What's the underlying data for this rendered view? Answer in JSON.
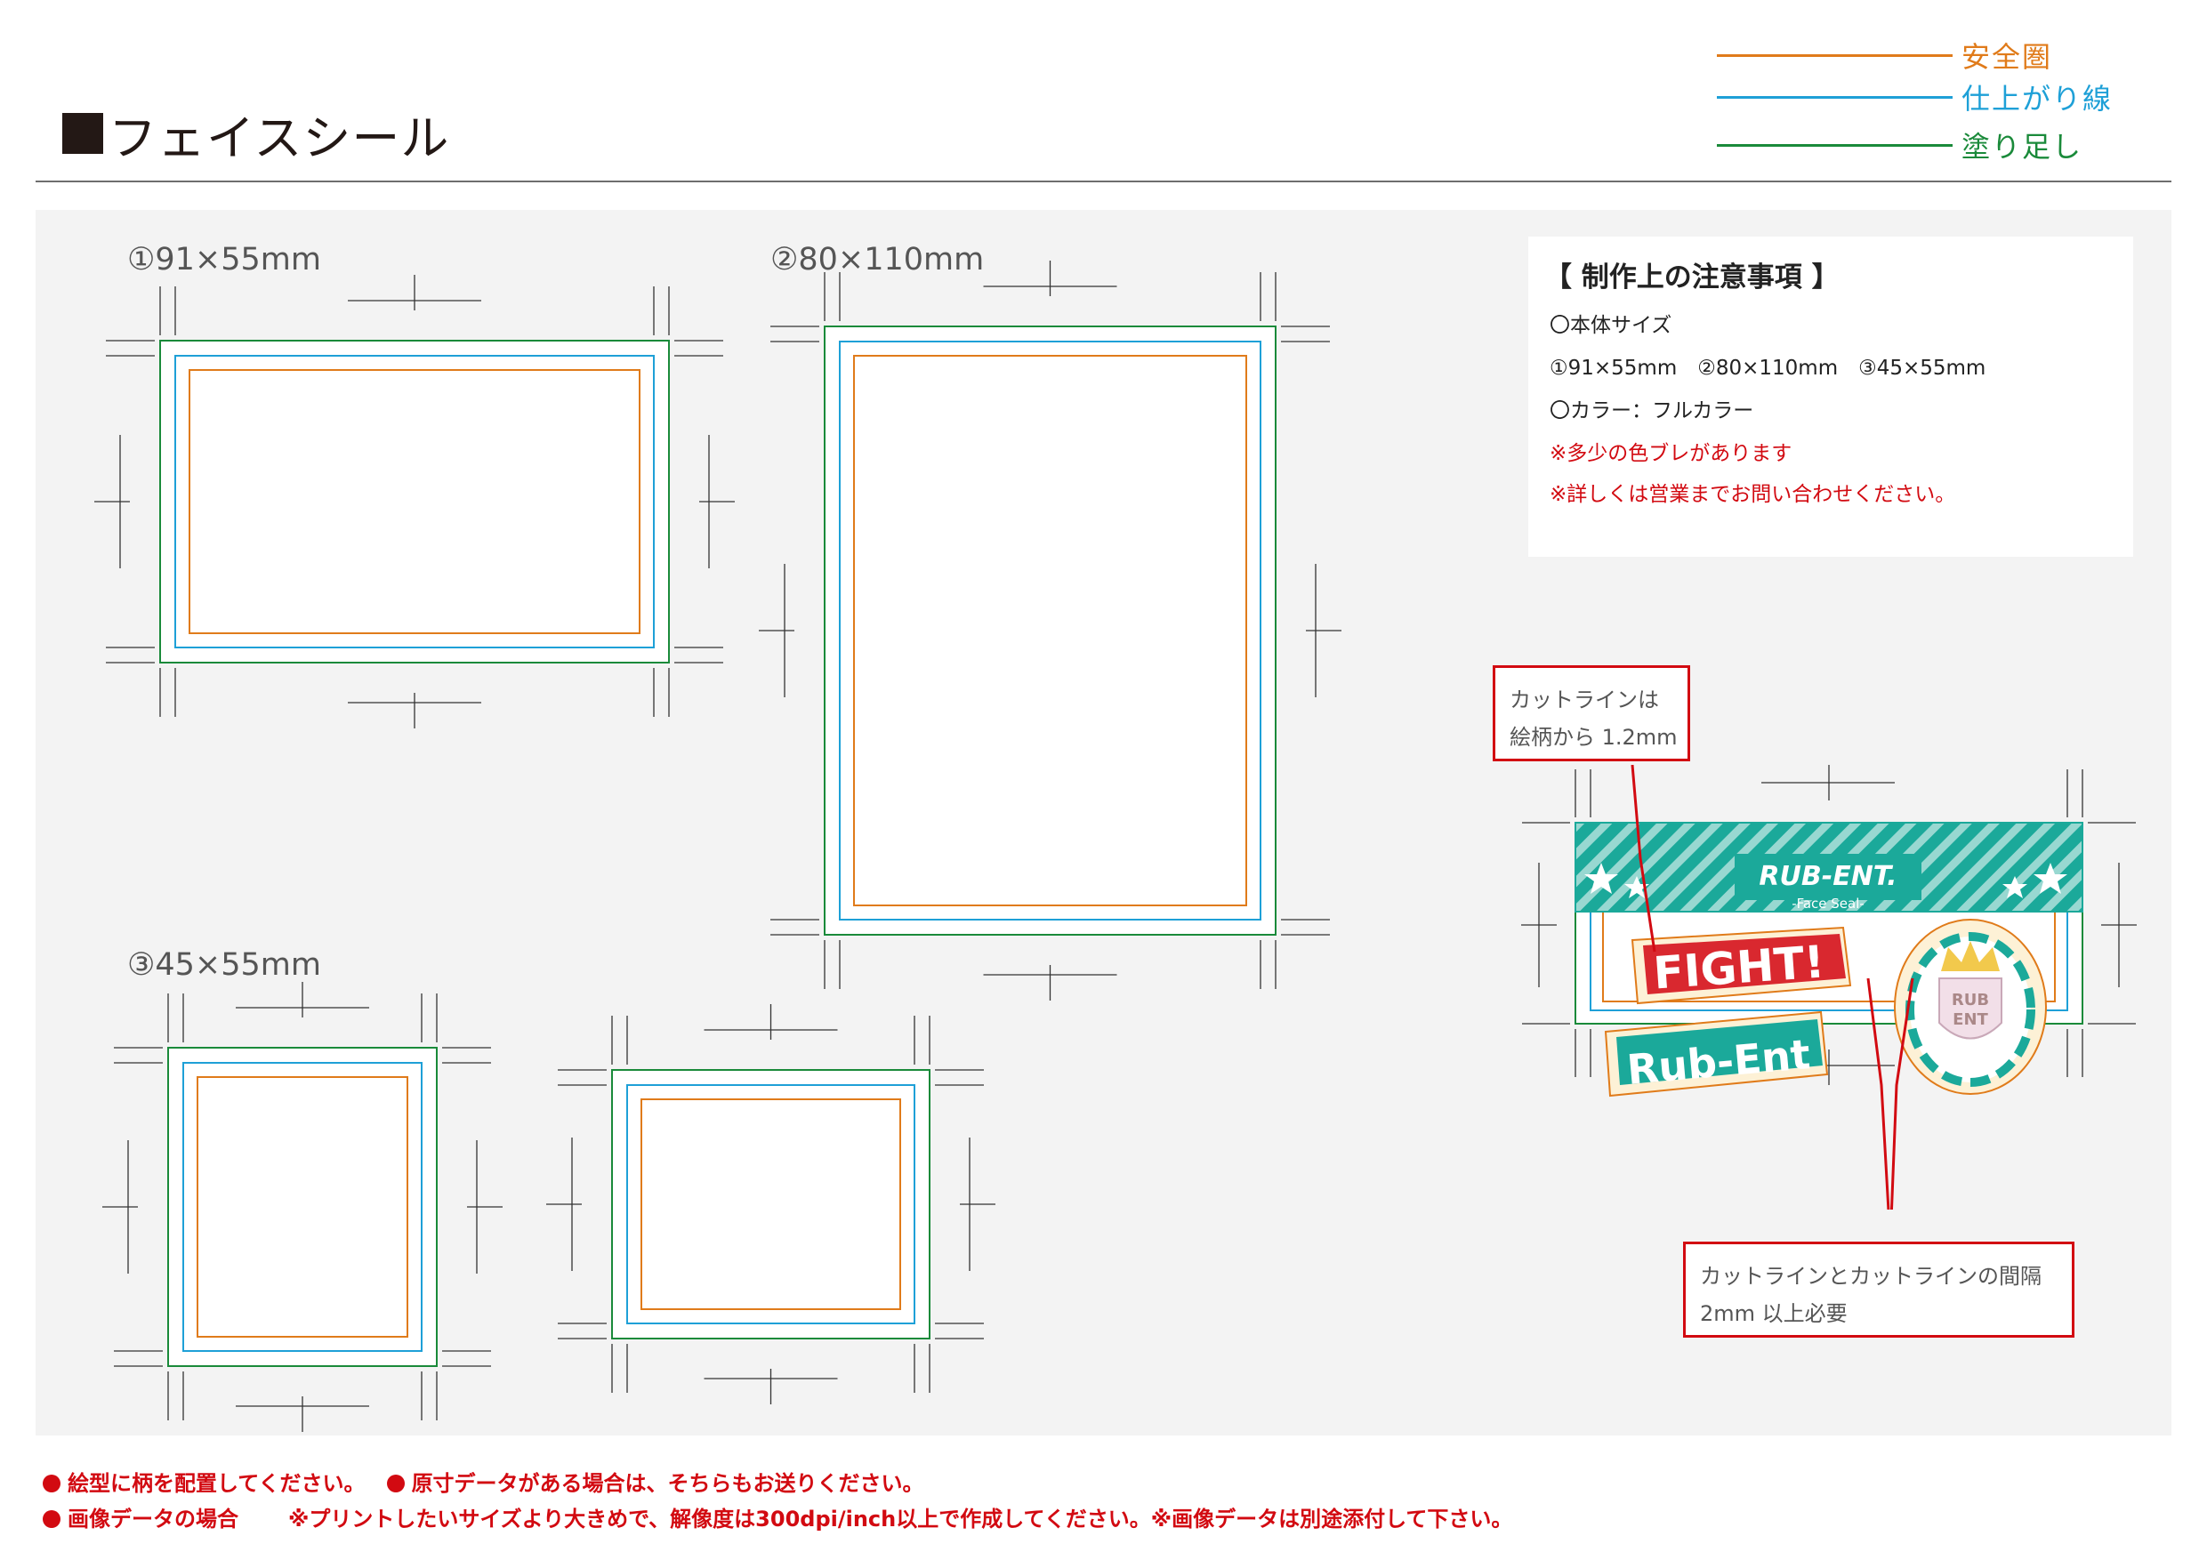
{
  "header": {
    "title": "フェイスシール"
  },
  "legend": [
    {
      "label": "安全圏",
      "color": "#e07b1a"
    },
    {
      "label": "仕上がり線",
      "color": "#1ea0d7"
    },
    {
      "label": "塗り足し",
      "color": "#1a8a3a"
    }
  ],
  "samples": {
    "s1_label": "①91×55mm",
    "s2_label": "②80×110mm",
    "s3_label": "③45×55mm"
  },
  "notes": {
    "title": "【 制作上の注意事項 】",
    "size_heading": "〇本体サイズ",
    "sizes": "①91×55mm　②80×110mm　③45×55mm",
    "color": "〇カラー：フルカラー",
    "warning1": "※多少の色ブレがあります",
    "warning2": "※詳しくは営業までお問い合わせください。"
  },
  "example": {
    "logo_text": "RUB-ENT.",
    "logo_sub": "-Face Seal-",
    "sticker1": "FIGHT!",
    "sticker2": "Rub-Ent",
    "badge_text1": "RUB",
    "badge_text2": "ENT"
  },
  "callouts": {
    "cut_line_1": "カットラインは",
    "cut_line_2": "絵柄から 1.2mm",
    "gap_1": "カットラインとカットラインの間隔",
    "gap_2": "2mm 以上必要"
  },
  "footer": {
    "line1_a": "絵型に柄を配置してください。",
    "line1_b": "原寸データがある場合は、そちらもお送りください。",
    "line2_a": "画像データの場合",
    "line2_b": "※プリントしたいサイズより大きめで、解像度は300dpi/inch以上で作成してください。※画像データは別途添付して下さい。"
  },
  "colors": {
    "safe": "#e07b1a",
    "trim": "#1ea0d7",
    "bleed": "#1a8a3a",
    "accent_red": "#d20a11",
    "teal": "#1ba99a"
  }
}
